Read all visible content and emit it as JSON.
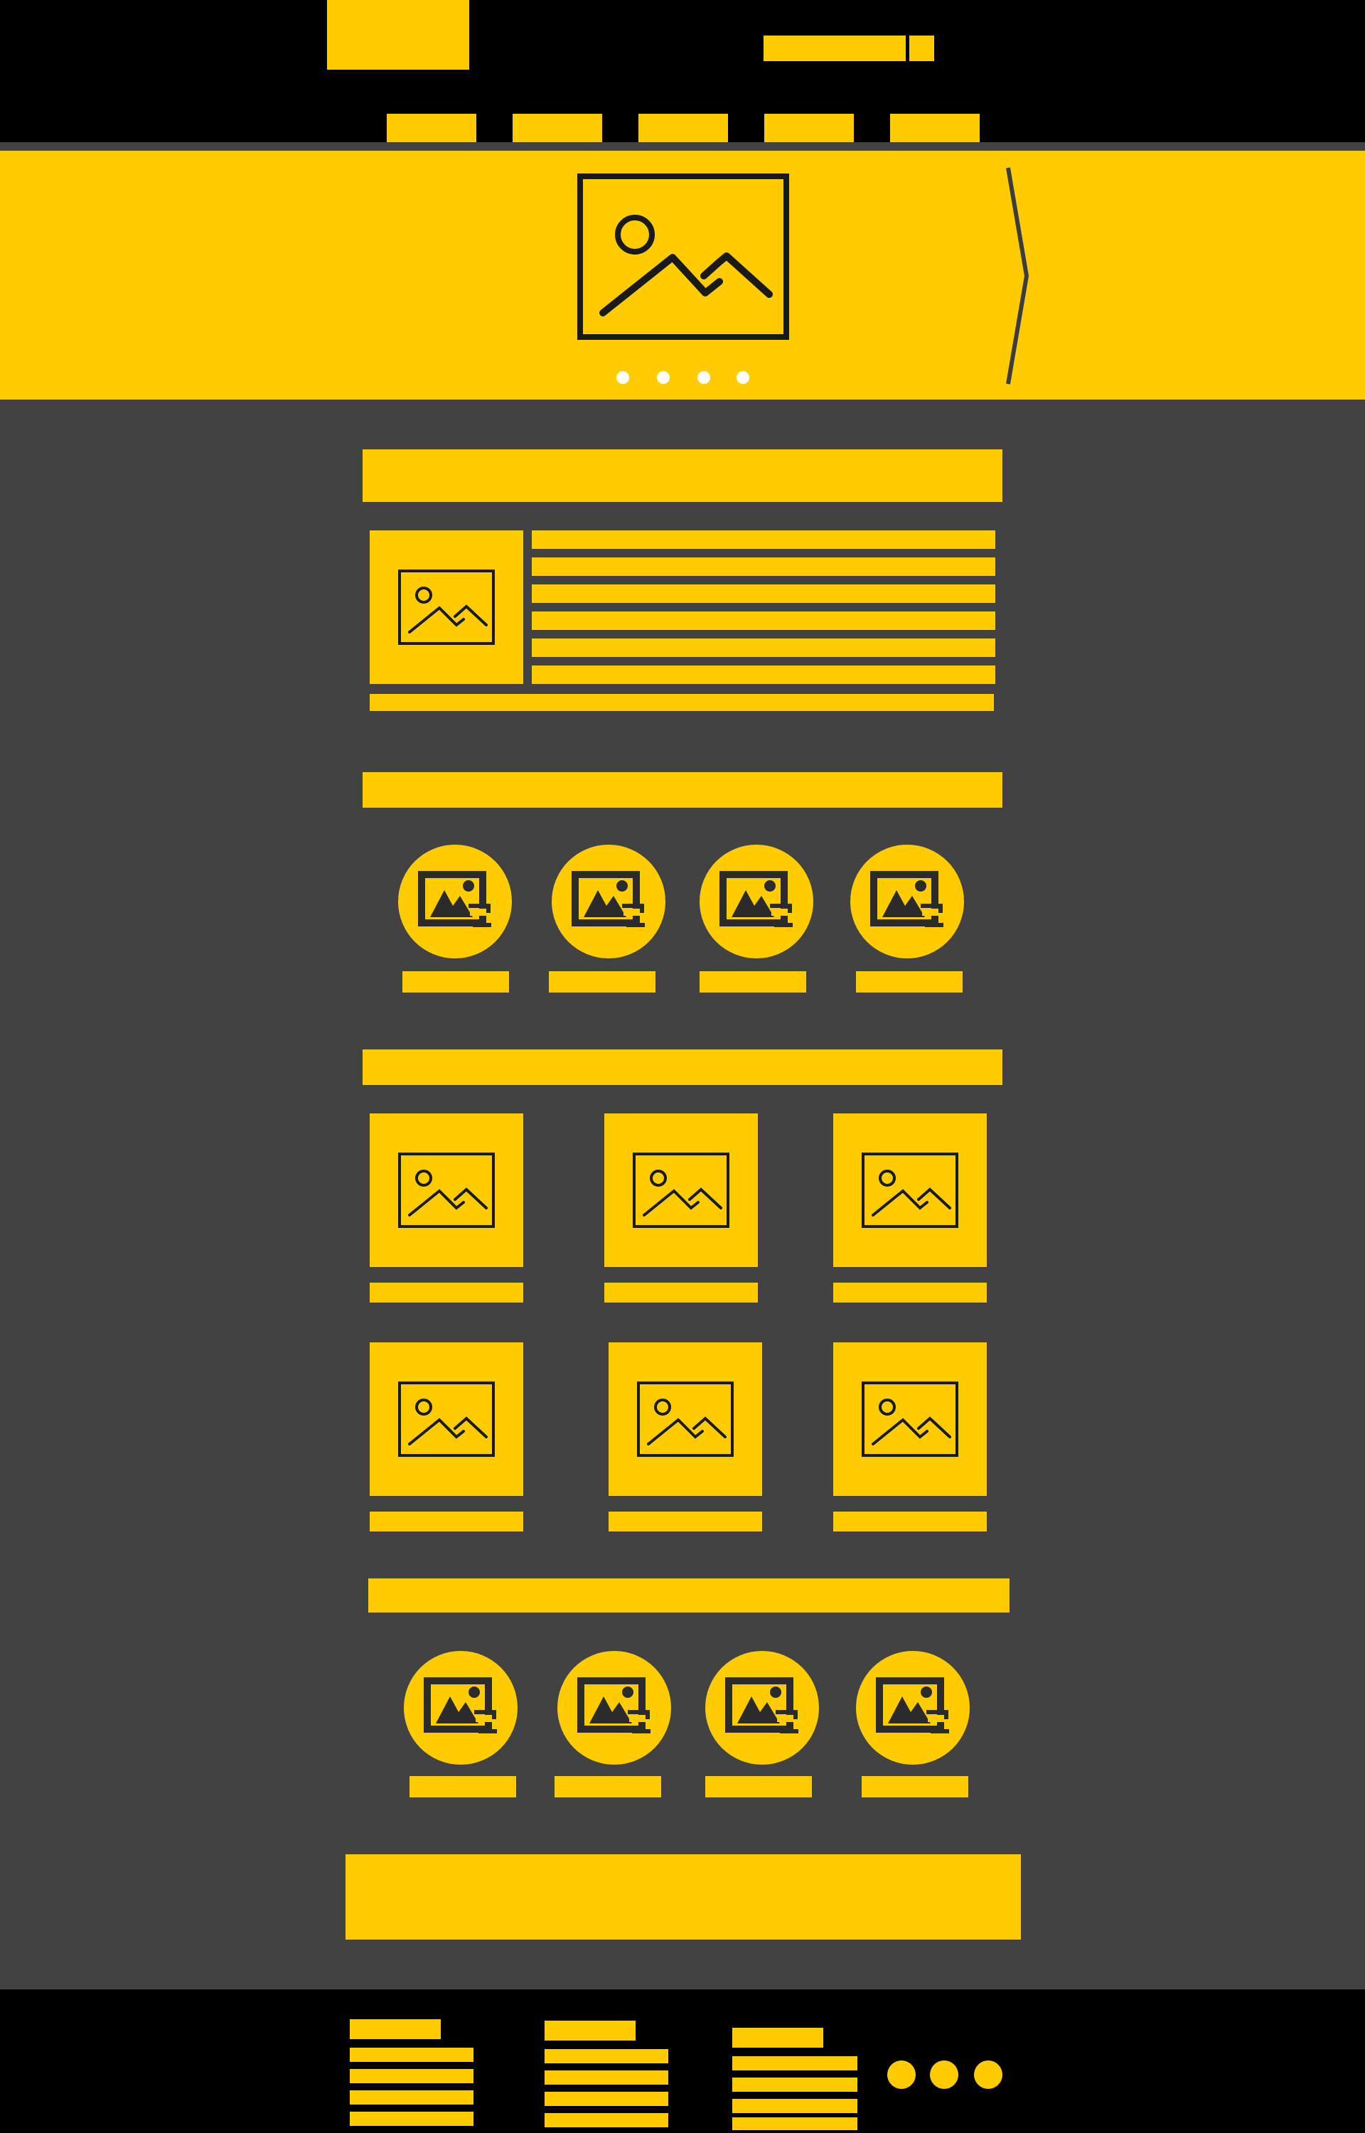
{
  "colors": {
    "accent": "#FFCC00",
    "panel": "#424242",
    "bar": "#000000",
    "dot": "#FFFFFF"
  },
  "icons": {
    "image": "image-placeholder-icon",
    "next": "chevron-right-icon",
    "round": "image-gallery-icon"
  },
  "hero": {
    "active_slide": 1,
    "slide_count": 4
  },
  "sections": {
    "gallery_rows": 2,
    "gallery_cols": 3,
    "circle_rows": 2,
    "circle_cols": 4
  }
}
